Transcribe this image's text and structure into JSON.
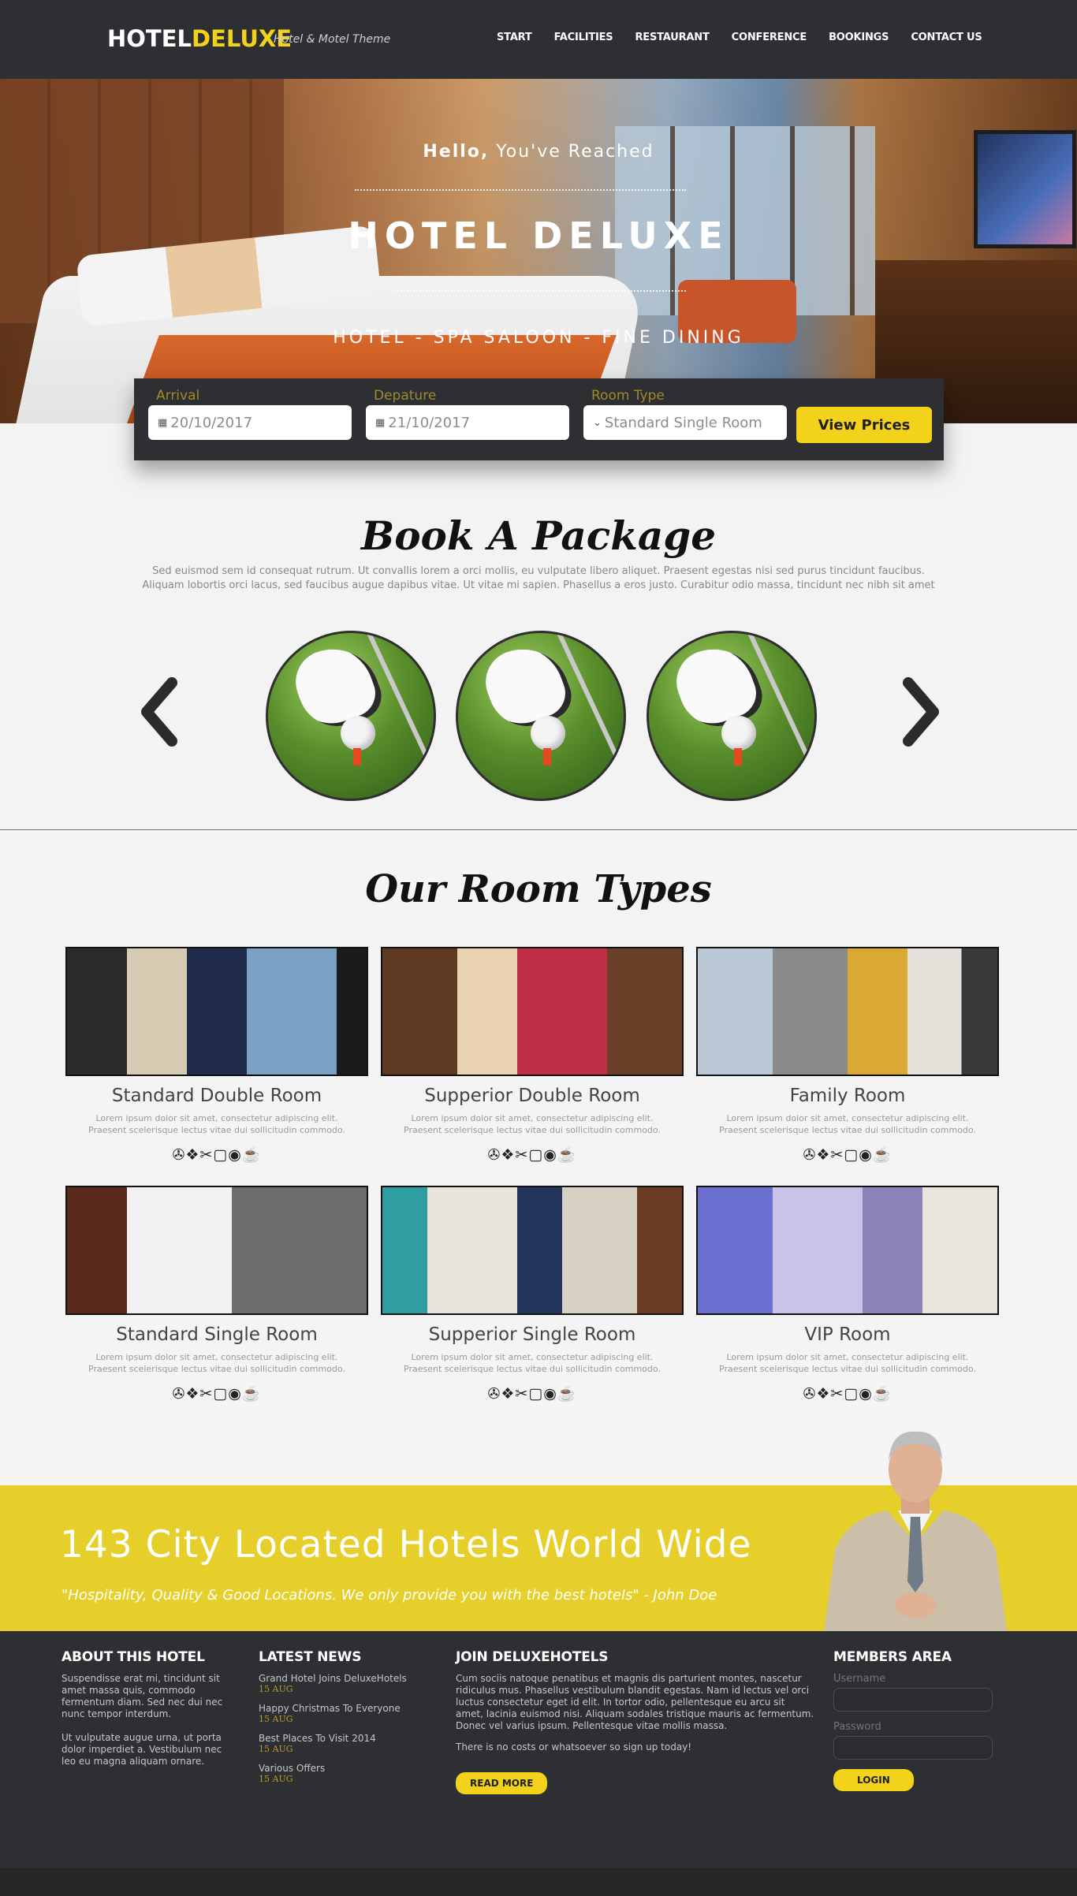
{
  "header": {
    "logo_part1": "HOTEL",
    "logo_part2": "DELUXE",
    "tagline": "Hotel & Motel Theme",
    "nav": [
      "START",
      "FACILITIES",
      "RESTAURANT",
      "CONFERENCE",
      "BOOKINGS",
      "CONTACT US"
    ]
  },
  "hero": {
    "hello_bold": "Hello,",
    "hello_rest": "You've Reached",
    "title": "HOTEL DELUXE",
    "subtitle": "HOTEL - SPA SALOON - FINE DINING"
  },
  "booking": {
    "arrival_label": "Arrival",
    "arrival_value": "20/10/2017",
    "departure_label": "Depature",
    "departure_value": "21/10/2017",
    "room_label": "Room Type",
    "room_placeholder": "Standard Single Room",
    "button": "View Prices"
  },
  "packages": {
    "title": "Book A Package",
    "description": "Sed euismod sem id consequat rutrum. Ut convallis lorem a orci mollis, eu vulputate libero aliquet. Praesent egestas nisi sed purus tincidunt faucibus. Aliquam lobortis orci lacus, sed faucibus augue dapibus vitae. Ut vitae mi sapien. Phasellus a eros justo. Curabitur odio massa, tincidunt nec nibh sit amet"
  },
  "rooms": {
    "title": "Our Room Types",
    "items": [
      {
        "name": "Standard Double Room",
        "desc": "Lorem ipsum dolor sit amet, consectetur adipiscing elit. Praesent scelerisque lectus vitae dui sollicitudin commodo.",
        "amenities": "✇❖✂▢◉☕"
      },
      {
        "name": "Supperior Double Room",
        "desc": "Lorem ipsum dolor sit amet, consectetur adipiscing elit. Praesent scelerisque lectus vitae dui sollicitudin commodo.",
        "amenities": "✇❖✂▢◉☕"
      },
      {
        "name": "Family Room",
        "desc": "Lorem ipsum dolor sit amet, consectetur adipiscing elit. Praesent scelerisque lectus vitae dui sollicitudin commodo.",
        "amenities": "✇❖✂▢◉☕"
      },
      {
        "name": "Standard Single Room",
        "desc": "Lorem ipsum dolor sit amet, consectetur adipiscing elit. Praesent scelerisque lectus vitae dui sollicitudin commodo.",
        "amenities": "✇❖✂▢◉☕"
      },
      {
        "name": "Supperior Single Room",
        "desc": "Lorem ipsum dolor sit amet, consectetur adipiscing elit. Praesent scelerisque lectus vitae dui sollicitudin commodo.",
        "amenities": "✇❖✂▢◉☕"
      },
      {
        "name": "VIP Room",
        "desc": "Lorem ipsum dolor sit amet, consectetur adipiscing elit. Praesent scelerisque lectus vitae dui sollicitudin commodo.",
        "amenities": "✇❖✂▢◉☕"
      }
    ]
  },
  "banner": {
    "title": "143 City Located Hotels World Wide",
    "quote": "\"Hospitality, Quality & Good Locations. We only provide you with the best hotels\" - John Doe"
  },
  "footer": {
    "about_title": "ABOUT THIS HOTEL",
    "about_p1": "Suspendisse erat mi, tincidunt sit amet massa quis, commodo fermentum diam. Sed nec dui nec nunc tempor interdum.",
    "about_p2": "Ut vulputate augue urna, ut porta dolor imperdiet a. Vestibulum nec leo eu magna aliquam ornare.",
    "news_title": "LATEST NEWS",
    "news": [
      {
        "title": "Grand Hotel Joins DeluxeHotels",
        "date": "15 AUG"
      },
      {
        "title": "Happy Christmas To Everyone",
        "date": "15 AUG"
      },
      {
        "title": "Best Places To Visit 2014",
        "date": "15 AUG"
      },
      {
        "title": "Various Offers",
        "date": "15 AUG"
      }
    ],
    "join_title": "JOIN DELUXEHOTELS",
    "join_p1": "Cum sociis natoque penatibus et magnis dis parturient montes, nascetur ridiculus mus. Phasellus vestibulum blandit egestas. Nam id lectus vel orci luctus consectetur eget id elit. In tortor odio, pellentesque eu arcu sit amet, lacinia euismod nisi. Aliquam sodales tristique mauris ac fermentum. Donec vel varius ipsum. Pellentesque vitae mollis massa.",
    "join_p2": "There is no costs or whatsoever so sign up today!",
    "read_more": "READ MORE",
    "members_title": "MEMBERS AREA",
    "username_label": "Username",
    "password_label": "Password",
    "login": "LOGIN"
  },
  "colors": {
    "accent": "#f2d21b",
    "dark": "#2d2f32",
    "banner": "#e6cf2a"
  }
}
